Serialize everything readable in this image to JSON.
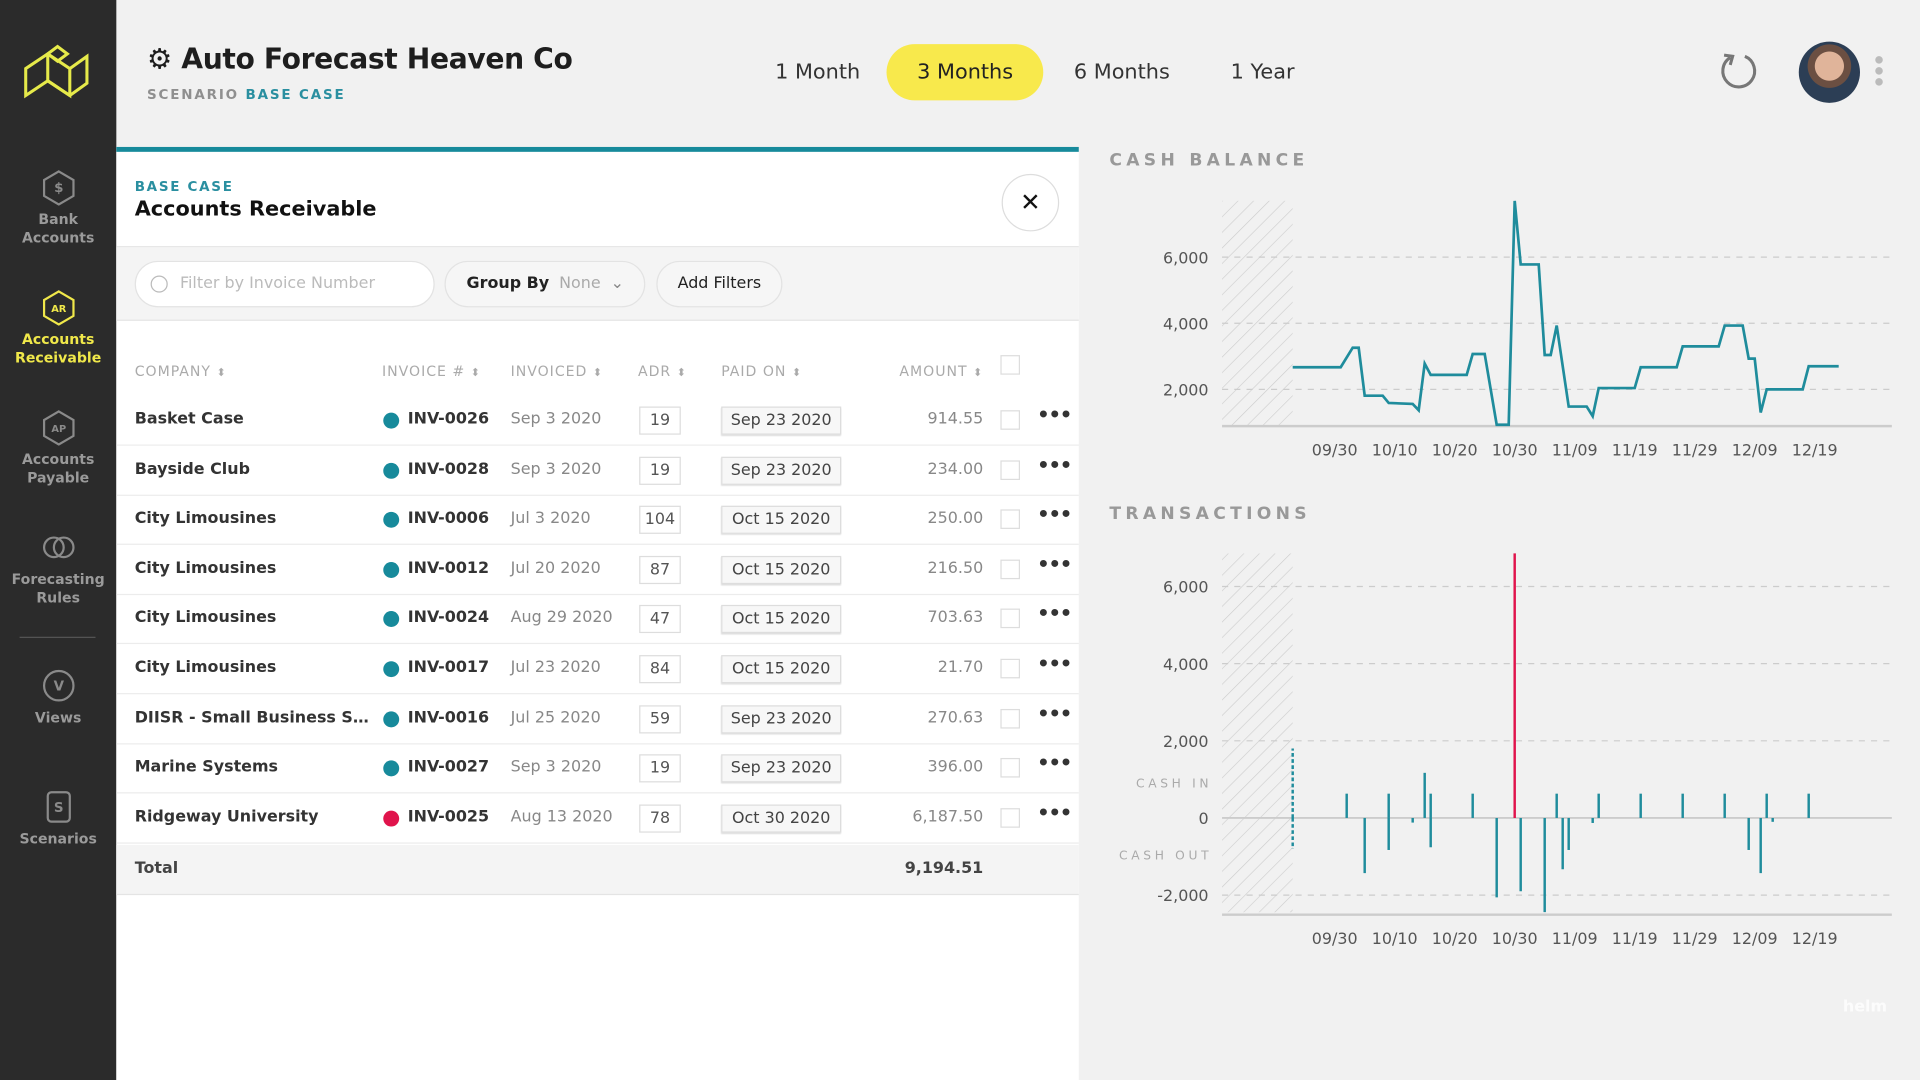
{
  "app": {
    "company": "Auto Forecast Heaven Co",
    "scenario_label": "SCENARIO",
    "scenario_value": "BASE CASE",
    "brand": "helm"
  },
  "colors": {
    "accent": "#f8e94c",
    "teal": "#178a9b",
    "red": "#e0144c",
    "sidebar": "#2b2b2b"
  },
  "sidebar": {
    "items": [
      {
        "label1": "Bank",
        "label2": "Accounts",
        "icon": "dollar-hexagon-icon",
        "glyph": "$",
        "active": false
      },
      {
        "label1": "Accounts",
        "label2": "Receivable",
        "icon": "ar-hexagon-icon",
        "glyph": "AR",
        "active": true
      },
      {
        "label1": "Accounts",
        "label2": "Payable",
        "icon": "ap-hexagon-icon",
        "glyph": "AP",
        "active": false
      },
      {
        "label1": "Forecasting",
        "label2": "Rules",
        "icon": "rules-icon",
        "glyph": "",
        "active": false
      },
      {
        "label1": "Views",
        "label2": "",
        "icon": "views-icon",
        "glyph": "V",
        "active": false
      },
      {
        "label1": "Scenarios",
        "label2": "",
        "icon": "scenarios-icon",
        "glyph": "S",
        "active": false
      }
    ]
  },
  "ranges": [
    {
      "label": "1 Month",
      "selected": false
    },
    {
      "label": "3 Months",
      "selected": true
    },
    {
      "label": "6 Months",
      "selected": false
    },
    {
      "label": "1 Year",
      "selected": false
    }
  ],
  "panel": {
    "breadcrumb": "BASE CASE",
    "title": "Accounts Receivable",
    "close": "✕",
    "search_placeholder": "Filter by Invoice Number",
    "group_by_label": "Group By",
    "group_by_value": "None",
    "add_filters": "Add Filters",
    "columns": [
      "COMPANY",
      "INVOICE #",
      "INVOICED",
      "ADR",
      "PAID ON",
      "AMOUNT"
    ],
    "rows": [
      {
        "company": "Basket Case",
        "status": "teal",
        "invoice": "INV-0026",
        "invoiced": "Sep 3 2020",
        "adr": "19",
        "paid_on": "Sep 23 2020",
        "amount": "914.55"
      },
      {
        "company": "Bayside Club",
        "status": "teal",
        "invoice": "INV-0028",
        "invoiced": "Sep 3 2020",
        "adr": "19",
        "paid_on": "Sep 23 2020",
        "amount": "234.00"
      },
      {
        "company": "City Limousines",
        "status": "teal",
        "invoice": "INV-0006",
        "invoiced": "Jul 3 2020",
        "adr": "104",
        "paid_on": "Oct 15 2020",
        "amount": "250.00"
      },
      {
        "company": "City Limousines",
        "status": "teal",
        "invoice": "INV-0012",
        "invoiced": "Jul 20 2020",
        "adr": "87",
        "paid_on": "Oct 15 2020",
        "amount": "216.50"
      },
      {
        "company": "City Limousines",
        "status": "teal",
        "invoice": "INV-0024",
        "invoiced": "Aug 29 2020",
        "adr": "47",
        "paid_on": "Oct 15 2020",
        "amount": "703.63"
      },
      {
        "company": "City Limousines",
        "status": "teal",
        "invoice": "INV-0017",
        "invoiced": "Jul 23 2020",
        "adr": "84",
        "paid_on": "Oct 15 2020",
        "amount": "21.70"
      },
      {
        "company": "DIISR - Small Business Services",
        "status": "teal",
        "invoice": "INV-0016",
        "invoiced": "Jul 25 2020",
        "adr": "59",
        "paid_on": "Sep 23 2020",
        "amount": "270.63"
      },
      {
        "company": "Marine Systems",
        "status": "teal",
        "invoice": "INV-0027",
        "invoiced": "Sep 3 2020",
        "adr": "19",
        "paid_on": "Sep 23 2020",
        "amount": "396.00"
      },
      {
        "company": "Ridgeway University",
        "status": "red",
        "invoice": "INV-0025",
        "invoiced": "Aug 13 2020",
        "adr": "78",
        "paid_on": "Oct 30 2020",
        "amount": "6,187.50"
      }
    ],
    "total_label": "Total",
    "total_amount": "9,194.51"
  },
  "chart_data": [
    {
      "type": "line",
      "title": "CASH BALANCE",
      "year": 2020,
      "ylim": [
        0,
        7800
      ],
      "yticks": [
        "2,000",
        "4,000",
        "6,000"
      ],
      "ytick_values": [
        2000,
        4000,
        6000
      ],
      "xticks": [
        "09/30",
        "10/10",
        "10/20",
        "10/30",
        "11/09",
        "11/19",
        "11/29",
        "12/09",
        "12/19"
      ],
      "grid": true,
      "shaded_until": "09/23",
      "x": [
        "09/23",
        "10/01",
        "10/03",
        "10/04",
        "10/05",
        "10/08",
        "10/09",
        "10/13",
        "10/14",
        "10/15",
        "10/16",
        "10/22",
        "10/23",
        "10/25",
        "10/27",
        "10/29",
        "10/30",
        "10/31",
        "11/03",
        "11/04",
        "11/05",
        "11/06",
        "11/08",
        "11/11",
        "11/12",
        "11/13",
        "11/19",
        "11/20",
        "11/26",
        "11/27",
        "12/03",
        "12/04",
        "12/07",
        "12/08",
        "12/09",
        "12/10",
        "12/11",
        "12/17",
        "12/18",
        "12/23"
      ],
      "y": [
        2670,
        2670,
        3260,
        3260,
        1810,
        1810,
        1590,
        1560,
        1370,
        2780,
        2440,
        2440,
        3070,
        3070,
        930,
        930,
        7700,
        5780,
        5780,
        3040,
        3040,
        3930,
        1480,
        1480,
        1190,
        2040,
        2040,
        2670,
        2670,
        3300,
        3300,
        3930,
        3930,
        2930,
        2930,
        1300,
        2000,
        2000,
        2700,
        2700
      ]
    },
    {
      "type": "bar",
      "title": "TRANSACTIONS",
      "year": 2020,
      "ylim": [
        -2500,
        7000
      ],
      "yticks": [
        "-2,000",
        "0",
        "2,000",
        "4,000",
        "6,000"
      ],
      "ytick_values": [
        -2000,
        0,
        2000,
        4000,
        6000
      ],
      "xticks": [
        "09/30",
        "10/10",
        "10/20",
        "10/30",
        "11/09",
        "11/19",
        "11/29",
        "12/09",
        "12/19"
      ],
      "grid": true,
      "shaded_until": "09/23",
      "labels": {
        "cash_in": "CASH IN",
        "cash_out": "CASH OUT"
      },
      "series": [
        {
          "x": [
            "09/23",
            "10/02",
            "10/09",
            "10/15",
            "10/16",
            "10/23",
            "10/30",
            "11/06",
            "11/13",
            "11/20",
            "11/27",
            "12/04",
            "12/11",
            "12/18"
          ],
          "values": [
            1800,
            630,
            630,
            1170,
            630,
            630,
            6860,
            630,
            630,
            630,
            630,
            630,
            630,
            630
          ],
          "highlight": "10/30"
        },
        {
          "x": [
            "09/23",
            "10/05",
            "10/09",
            "10/13",
            "10/16",
            "10/27",
            "10/31",
            "11/04",
            "11/07",
            "11/08",
            "11/12",
            "12/08",
            "12/10",
            "12/12"
          ],
          "values": [
            -800,
            -1430,
            -830,
            -120,
            -760,
            -2060,
            -1900,
            -2440,
            -1330,
            -830,
            -130,
            -830,
            -1430,
            -100
          ]
        }
      ]
    }
  ]
}
